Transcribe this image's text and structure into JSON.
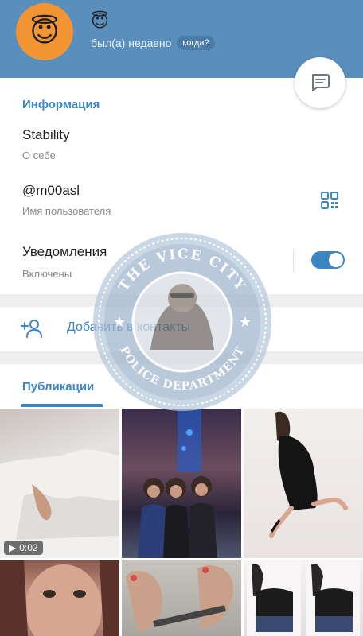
{
  "header": {
    "avatar_emoji": "😇",
    "status_emoji": "😇",
    "last_seen": "был(а) недавно",
    "last_seen_pill": "когда?",
    "color": "#5b8fbb"
  },
  "info": {
    "title": "Информация",
    "bio_value": "Stability",
    "bio_label": "О себе",
    "username_value": "@m00asl",
    "username_label": "Имя пользователя",
    "notifications_value": "Уведомления",
    "notifications_label": "Включены",
    "notifications_on": true
  },
  "actions": {
    "add_contact": "Добавить в контакты"
  },
  "publications": {
    "tab_label": "Публикации",
    "tiles": [
      {
        "duration": "0:02",
        "kind": "video"
      },
      {
        "kind": "photo"
      },
      {
        "kind": "photo"
      },
      {
        "kind": "photo"
      },
      {
        "kind": "photo"
      },
      {
        "kind": "photo"
      }
    ]
  },
  "watermark": {
    "text_top": "THE VICE CITY",
    "text_bottom": "POLICE DEPARTMENT"
  },
  "colors": {
    "accent": "#3d86c4",
    "header": "#5b8fbb",
    "avatar": "#f39533"
  }
}
